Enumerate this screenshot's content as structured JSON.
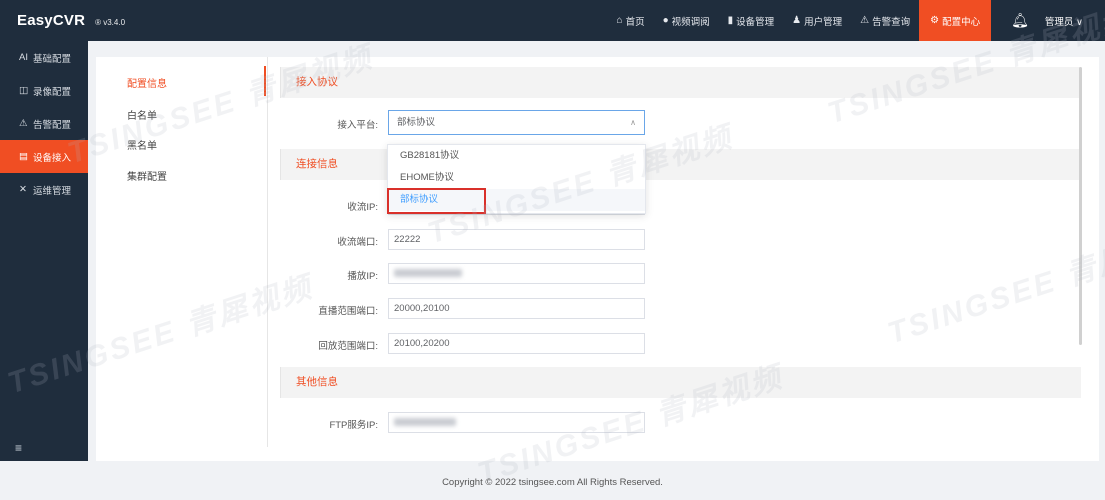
{
  "app": {
    "name": "EasyCVR",
    "version": "® v3.4.0"
  },
  "topnav": [
    {
      "icon": "home-icon",
      "glyph": "⌂",
      "label": "首页"
    },
    {
      "icon": "video-icon",
      "glyph": "●",
      "label": "视频调阅"
    },
    {
      "icon": "device-icon",
      "glyph": "▮",
      "label": "设备管理"
    },
    {
      "icon": "user-icon",
      "glyph": "♟",
      "label": "用户管理"
    },
    {
      "icon": "alarm-icon",
      "glyph": "⚠",
      "label": "告警查询"
    },
    {
      "icon": "gear-icon",
      "glyph": "⚙",
      "label": "配置中心"
    }
  ],
  "user": {
    "label": "管理员 ∨"
  },
  "sidebar": [
    {
      "icon": "ai-icon",
      "glyph": "AI",
      "label": "基础配置"
    },
    {
      "icon": "record-icon",
      "glyph": "◫",
      "label": "录像配置"
    },
    {
      "icon": "alarm-config-icon",
      "glyph": "⚠",
      "label": "告警配置"
    },
    {
      "icon": "device-access-icon",
      "glyph": "▤",
      "label": "设备接入"
    },
    {
      "icon": "tools-icon",
      "glyph": "✕",
      "label": "运维管理"
    }
  ],
  "subnav": [
    "配置信息",
    "白名单",
    "黑名单",
    "集群配置"
  ],
  "sections": {
    "access": "接入协议",
    "connection": "连接信息",
    "other": "其他信息"
  },
  "form": {
    "platform_label": "接入平台:",
    "platform_value": "部标协议",
    "stream_ip_label": "收流IP:",
    "stream_port_label": "收流端口:",
    "stream_port_value": "22222",
    "play_ip_label": "播放IP:",
    "live_range_label": "直播范围端口:",
    "live_range_value": "20000,20100",
    "playback_range_label": "回放范围端口:",
    "playback_range_value": "20100,20200",
    "ftp_label": "FTP服务IP:"
  },
  "dropdown": [
    "GB28181协议",
    "EHOME协议",
    "部标协议"
  ],
  "watermark": "TSINGSEE 青犀视频",
  "footer": "Copyright © 2022 tsingsee.com All Rights Reserved.",
  "colors": {
    "accent": "#f04e23",
    "header": "#1f2d3d",
    "selected_option": "#409eff",
    "highlight_box": "#d9302a"
  }
}
